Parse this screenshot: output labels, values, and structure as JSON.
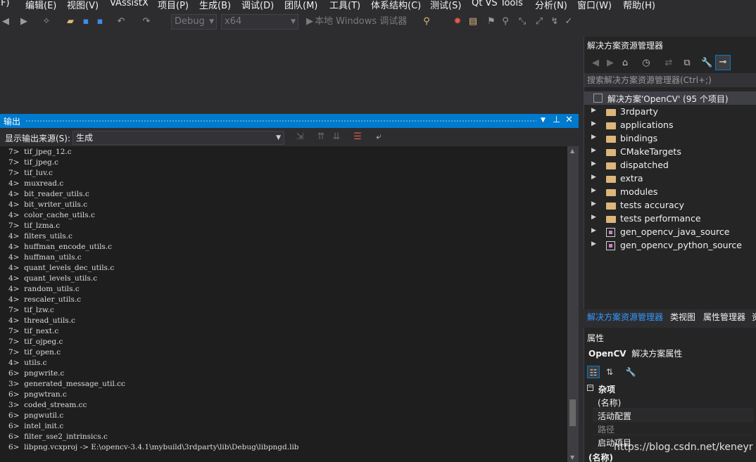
{
  "menu": [
    "(F)",
    "编辑(E)",
    "视图(V)",
    "VAssistX",
    "项目(P)",
    "生成(B)",
    "调试(D)",
    "团队(M)",
    "工具(T)",
    "体系结构(C)",
    "测试(S)",
    "Qt VS Tools",
    "分析(N)",
    "窗口(W)",
    "帮助(H)"
  ],
  "toolbar": {
    "config": "Debug",
    "platform": "x64",
    "run_label": "本地 Windows 调试器"
  },
  "output": {
    "title": "输出",
    "source_label": "显示输出来源(S):",
    "source_value": "生成",
    "lines": [
      "7>  tif_jpeg_12.c",
      "7>  tif_jpeg.c",
      "7>  tif_luv.c",
      "4>  muxread.c",
      "4>  bit_reader_utils.c",
      "4>  bit_writer_utils.c",
      "4>  color_cache_utils.c",
      "7>  tif_lzma.c",
      "4>  filters_utils.c",
      "4>  huffman_encode_utils.c",
      "4>  huffman_utils.c",
      "4>  quant_levels_dec_utils.c",
      "4>  quant_levels_utils.c",
      "4>  random_utils.c",
      "4>  rescaler_utils.c",
      "7>  tif_lzw.c",
      "4>  thread_utils.c",
      "7>  tif_next.c",
      "7>  tif_ojpeg.c",
      "7>  tif_open.c",
      "4>  utils.c",
      "6>  pngwrite.c",
      "3>  generated_message_util.cc",
      "6>  pngwtran.c",
      "3>  coded_stream.cc",
      "6>  pngwutil.c",
      "6>  intel_init.c",
      "6>  filter_sse2_intrinsics.c",
      "6>  libpng.vcxproj -> E:\\opencv-3.4.1\\mybuild\\3rdparty\\lib\\Debug\\libpngd.lib"
    ]
  },
  "solution_explorer": {
    "title": "解决方案资源管理器",
    "search_placeholder": "搜索解决方案资源管理器(Ctrl+;)",
    "root": "解决方案'OpenCV' (95 个项目)",
    "items": [
      {
        "label": "3rdparty",
        "kind": "folder"
      },
      {
        "label": "applications",
        "kind": "folder"
      },
      {
        "label": "bindings",
        "kind": "folder"
      },
      {
        "label": "CMakeTargets",
        "kind": "folder"
      },
      {
        "label": "dispatched",
        "kind": "folder"
      },
      {
        "label": "extra",
        "kind": "folder"
      },
      {
        "label": "modules",
        "kind": "folder"
      },
      {
        "label": "tests accuracy",
        "kind": "folder"
      },
      {
        "label": "tests performance",
        "kind": "folder"
      },
      {
        "label": "gen_opencv_java_source",
        "kind": "project"
      },
      {
        "label": "gen_opencv_python_source",
        "kind": "project"
      }
    ]
  },
  "tabs": [
    "解决方案资源管理器",
    "类视图",
    "属性管理器",
    "资"
  ],
  "properties": {
    "title": "属性",
    "object_name": "OpenCV",
    "object_type": "解决方案属性",
    "category": "杂项",
    "rows": [
      "(名称)",
      "活动配置",
      "路径",
      "启动项目"
    ],
    "footer": "(名称)"
  },
  "watermark": "https://blog.csdn.net/keneyr",
  "colors": {
    "accent": "#007acc",
    "background": "#2d2d30",
    "output_bg": "#1e1e1e",
    "tab_active": "#3399ff",
    "folder": "#dcb67a"
  }
}
